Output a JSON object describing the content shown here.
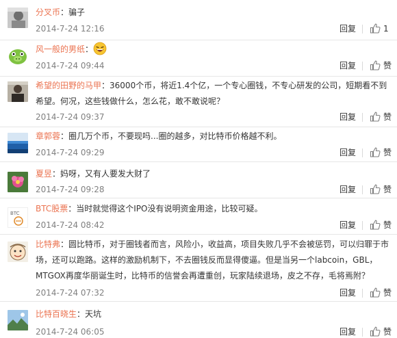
{
  "comments": [
    {
      "user": "分叉币",
      "colon": "：",
      "text": "骗子",
      "time": "2014-7-24 12:16",
      "reply": "回复",
      "like": "1",
      "avatar": "avatar-portrait-gray"
    },
    {
      "user": "风一般的男纸",
      "colon": "：",
      "text": "",
      "time": "2014-7-24 09:44",
      "reply": "回复",
      "like": "赞",
      "avatar": "avatar-green-pig",
      "emoji": "laughing-emoji"
    },
    {
      "user": "希望的田野的马甲",
      "colon": "：",
      "text": "36000个币，将近1.4个亿，一个专心圈钱，不专心研发的公司，短期看不到希望。何况，这些钱做什么，怎么花，敢不敢说呢？",
      "time": "2014-7-24 09:37",
      "reply": "回复",
      "like": "赞",
      "avatar": "avatar-person-dark"
    },
    {
      "user": "章郭蓉",
      "colon": "：",
      "text": "圈几万个币，不要现吗...圈的越多，对比特币价格越不利。",
      "time": "2014-7-24 09:29",
      "reply": "回复",
      "like": "赞",
      "avatar": "avatar-blue-sea"
    },
    {
      "user": "夏昱",
      "colon": "：",
      "text": "妈呀，又有人要发大财了",
      "time": "2014-7-24 09:28",
      "reply": "回复",
      "like": "赞",
      "avatar": "avatar-flower-pink"
    },
    {
      "user": "BTC股票",
      "colon": "：",
      "text": "当时就觉得这个IPO没有说明资金用途，比较可疑。",
      "time": "2014-7-24 08:42",
      "reply": "回复",
      "like": "赞",
      "avatar": "avatar-btc-logo"
    },
    {
      "user": "比特弗",
      "colon": "：",
      "text": "圆比特币，对于圈钱者而言，风险小，收益高，项目失败几乎不会被惩罚，可以归罪于市场，还可以跑路。这样的激励机制下，不去圈钱反而显得傻逼。但是当另一个labcoin，GBL，MTGOX再度华丽诞生时，比特币的信誉会再遭重创，玩家陆续退场，皮之不存，毛将焉附？",
      "time": "2014-7-24 07:32",
      "reply": "回复",
      "like": "赞",
      "avatar": "avatar-cartoon-face"
    },
    {
      "user": "比特百晓生",
      "colon": "：",
      "text": "天坑",
      "time": "2014-7-24 06:05",
      "reply": "回复",
      "like": "赞",
      "avatar": "avatar-landscape"
    }
  ],
  "colors": {
    "username": "#eb7350",
    "text": "#333333",
    "meta": "#808080",
    "divider": "#e6e6e6"
  }
}
